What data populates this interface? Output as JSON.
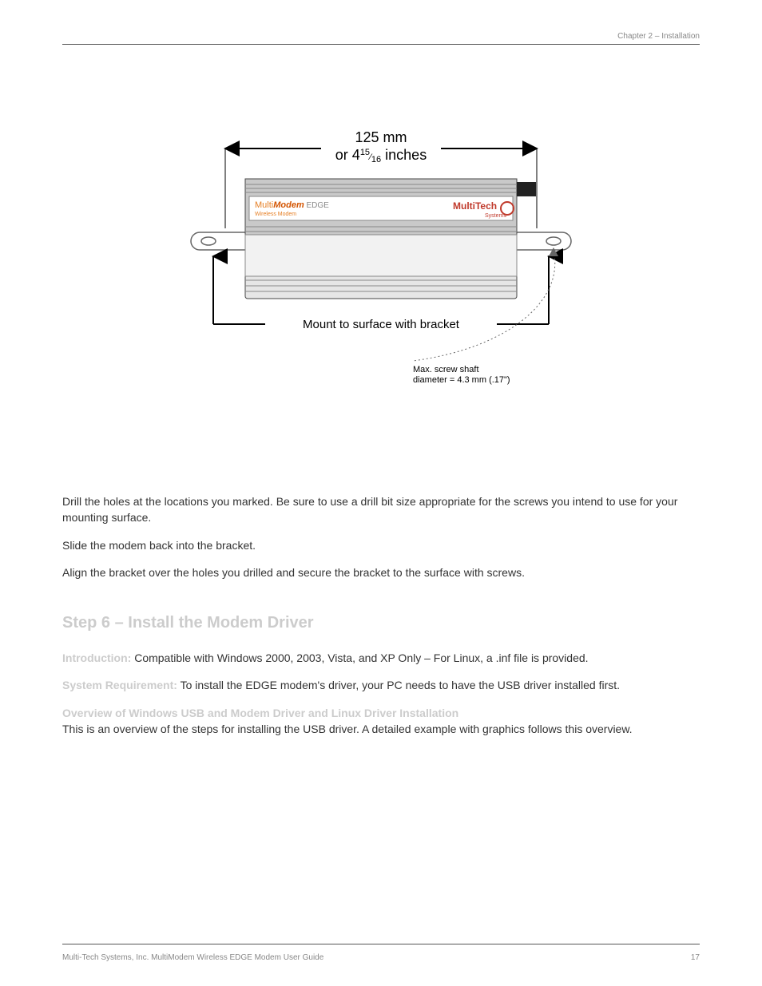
{
  "header": {
    "left": "",
    "right": "Chapter 2 – Installation"
  },
  "footer": {
    "left": "Multi-Tech Systems, Inc. MultiModem Wireless EDGE Modem User Guide",
    "right": "17"
  },
  "instructions": {
    "para1": "Drill the holes at the locations you marked. Be sure to use a drill bit size appropriate for the screws you intend to use for your mounting surface.",
    "para2": "Slide the modem back into the bracket.",
    "para3": "Align the bracket over the holes you drilled and secure the bracket to the surface with screws."
  },
  "section": {
    "title": "Step 6 – Install the Modem Driver",
    "intro_label": "Introduction:",
    "intro_text": " Compatible with Windows 2000, 2003, Vista, and XP Only – For Linux, a .inf file is provided.",
    "req_label": "System Requirement:",
    "req_text": " To install the EDGE modem's driver, your PC needs to have the USB driver installed first.",
    "overview_label": "Overview of Windows USB and Modem Driver and Linux Driver Installation",
    "overview_text": " This is an overview of the steps for installing the USB driver. A detailed example with graphics follows this overview."
  },
  "figure": {
    "dim_top_line1": "125 mm",
    "dim_top_line2_prefix": "or 4",
    "dim_top_line2_num": "15",
    "dim_top_line2_den": "16",
    "dim_top_line2_suffix": " inches",
    "label_top_left": "Multi",
    "label_top_mid": "Modem",
    "label_top_edge": " EDGE",
    "label_top_sub": "Wireless Modem",
    "label_top_right_brand": "MultiTech",
    "label_top_right_sub": "Systems",
    "mount_text": "Mount to surface with bracket",
    "screw_line1": "Max. screw shaft",
    "screw_line2": "diameter = 4.3 mm (.17\")"
  }
}
